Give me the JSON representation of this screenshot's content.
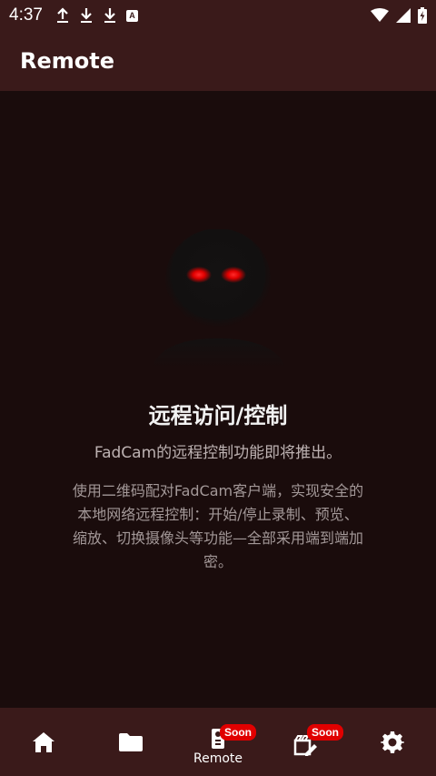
{
  "status_bar": {
    "time": "4:37",
    "a_icon_letter": "A"
  },
  "app_bar": {
    "title": "Remote"
  },
  "main": {
    "headline": "远程访问/控制",
    "subline": "FadCam的远程控制功能即将推出。",
    "desc_line1": "使用二维码配对FadCam客户端，实现安全的",
    "desc_line2": "本地网络远程控制：开始/停止录制、预览、",
    "desc_line3": "缩放、切换摄像头等功能—全部采用端到端加",
    "desc_line4": "密。"
  },
  "bottom_nav": {
    "items": [
      {
        "name": "home",
        "icon": "home-icon",
        "label": ""
      },
      {
        "name": "files",
        "icon": "folder-icon",
        "label": ""
      },
      {
        "name": "remote",
        "icon": "remote-icon",
        "label": "Remote",
        "badge": "Soon"
      },
      {
        "name": "editor",
        "icon": "video-edit-icon",
        "label": "",
        "badge": "Soon"
      },
      {
        "name": "settings",
        "icon": "gear-icon",
        "label": ""
      }
    ]
  },
  "colors": {
    "bar_background": "#3a1a1a",
    "content_background": "#1a0c0c",
    "badge": "#e00000",
    "eye_glow": "#ff1010"
  }
}
